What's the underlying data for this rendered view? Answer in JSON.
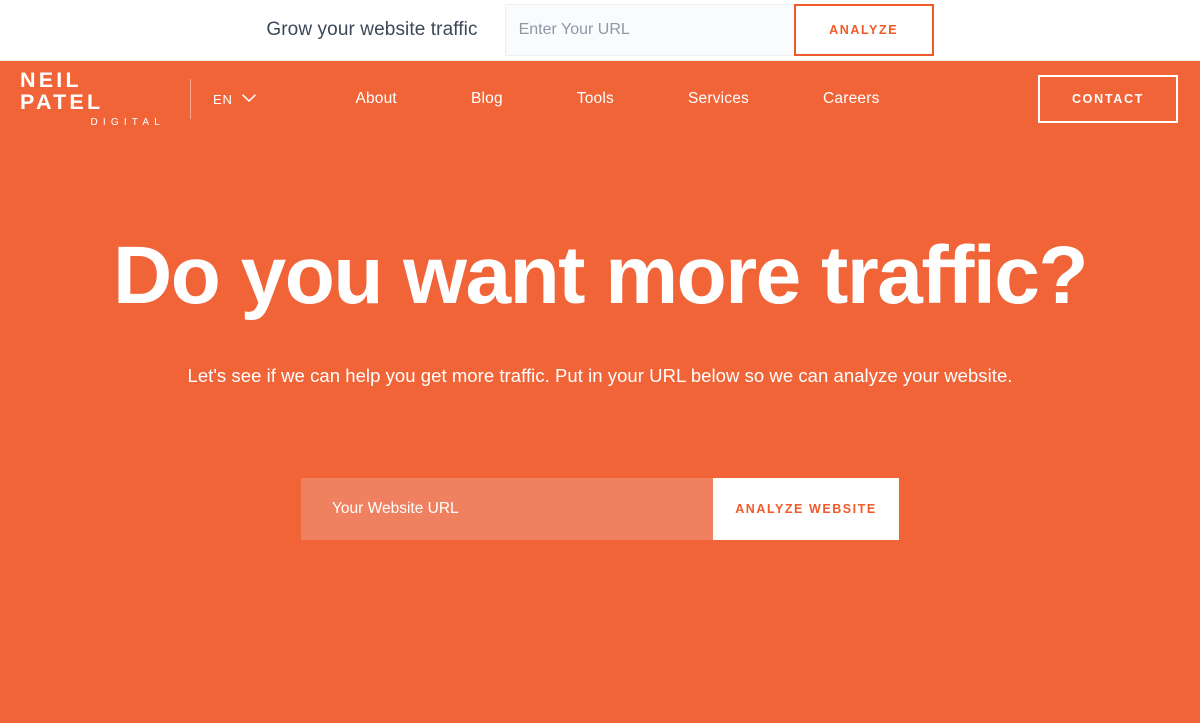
{
  "topbar": {
    "label": "Grow your website traffic",
    "input_placeholder": "Enter Your URL",
    "input_value": "",
    "analyze_label": "ANALYZE"
  },
  "nav": {
    "logo_main": "NEIL PATEL",
    "logo_sub": "DIGITAL",
    "language": "EN",
    "links": [
      {
        "label": "About"
      },
      {
        "label": "Blog"
      },
      {
        "label": "Tools"
      },
      {
        "label": "Services"
      },
      {
        "label": "Careers"
      }
    ],
    "contact_label": "CONTACT"
  },
  "hero": {
    "headline": "Do you want more traffic?",
    "subheadline": "Let's see if we can help you get more traffic. Put in your URL below so we can analyze your website.",
    "input_placeholder": "Your Website URL",
    "input_value": "",
    "submit_label": "ANALYZE WEBSITE"
  },
  "colors": {
    "brand_orange": "#F06438",
    "accent_orange": "#F05A28",
    "input_orange": "#F08160",
    "white": "#FFFFFF",
    "topbar_text": "#3C4858",
    "placeholder_gray": "#8C98A4"
  }
}
